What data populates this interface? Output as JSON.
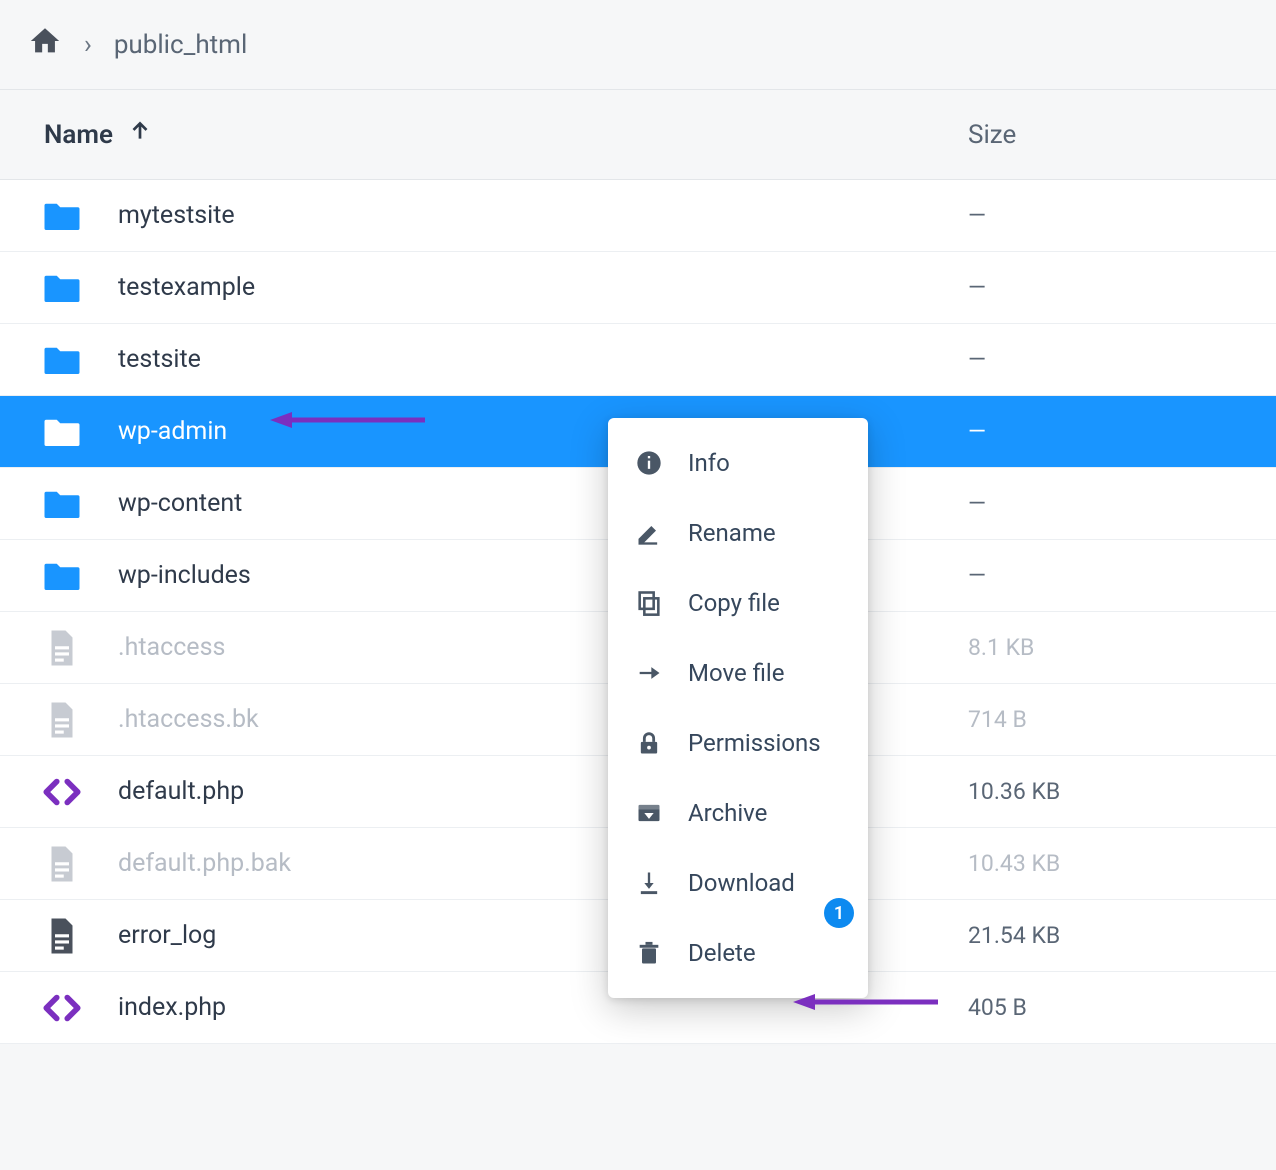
{
  "breadcrumb": {
    "current": "public_html"
  },
  "columns": {
    "name": "Name",
    "size": "Size"
  },
  "rows": [
    {
      "icon": "folder-blue",
      "name": "mytestsite",
      "size": "—",
      "type": "folder"
    },
    {
      "icon": "folder-blue",
      "name": "testexample",
      "size": "—",
      "type": "folder"
    },
    {
      "icon": "folder-blue",
      "name": "testsite",
      "size": "—",
      "type": "folder"
    },
    {
      "icon": "folder-white",
      "name": "wp-admin",
      "size": "—",
      "type": "folder",
      "selected": true
    },
    {
      "icon": "folder-blue",
      "name": "wp-content",
      "size": "—",
      "type": "folder"
    },
    {
      "icon": "folder-blue",
      "name": "wp-includes",
      "size": "—",
      "type": "folder"
    },
    {
      "icon": "file-grey",
      "name": ".htaccess",
      "size": "8.1 KB",
      "type": "file",
      "dimmed": true
    },
    {
      "icon": "file-grey",
      "name": ".htaccess.bk",
      "size": "714 B",
      "type": "file",
      "dimmed": true
    },
    {
      "icon": "code",
      "name": "default.php",
      "size": "10.36 KB",
      "type": "code"
    },
    {
      "icon": "file-grey",
      "name": "default.php.bak",
      "size": "10.43 KB",
      "type": "file",
      "dimmed": true
    },
    {
      "icon": "file-dark",
      "name": "error_log",
      "size": "21.54 KB",
      "type": "file"
    },
    {
      "icon": "code",
      "name": "index.php",
      "size": "405 B",
      "type": "code"
    }
  ],
  "context_menu": {
    "items": [
      {
        "icon": "info",
        "label": "Info"
      },
      {
        "icon": "rename",
        "label": "Rename"
      },
      {
        "icon": "copy",
        "label": "Copy file"
      },
      {
        "icon": "move",
        "label": "Move file"
      },
      {
        "icon": "perm",
        "label": "Permissions"
      },
      {
        "icon": "archive",
        "label": "Archive"
      },
      {
        "icon": "download",
        "label": "Download",
        "badge": "1"
      },
      {
        "icon": "delete",
        "label": "Delete"
      }
    ]
  }
}
